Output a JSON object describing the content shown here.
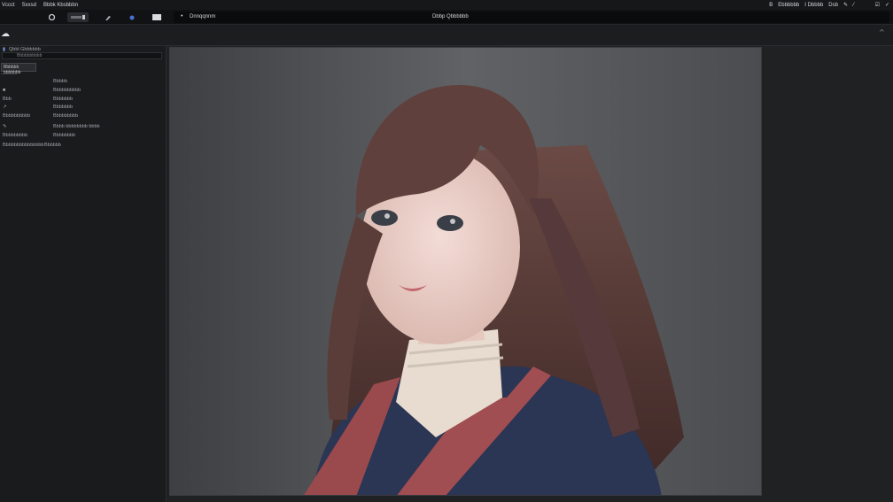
{
  "app": {
    "menu": [
      "Vccct",
      "Sxxsd",
      "Bbbk Kbsbbbn"
    ],
    "document_title": "Dbbp Qbbbbbb",
    "tab_label": "Dnnqqnnm",
    "status_right": [
      "B",
      "Ebbbbbb",
      "I Dbbbb",
      "Dsb"
    ]
  },
  "panel": {
    "header": "Qbbl Gbbbbbb",
    "search_value": "Bbbbbbbbbb",
    "section_label": "Bbbbbb bbbbbbb",
    "rows": [
      {
        "left": "",
        "mid": "Bbbbb",
        "right": ""
      },
      {
        "left": "",
        "mid": "",
        "right": "Bbbbbbbbbb"
      },
      {
        "left": "Bbb",
        "mid": "",
        "right": "Bbbbbbb"
      },
      {
        "left": "",
        "mid": "",
        "right": "Bbbbbbb"
      },
      {
        "left": "Bbbbbbbbbb",
        "mid": "",
        "right": "Bbbbbbbbb"
      },
      {
        "left": "",
        "mid": "",
        "right": "Bbbb bbbbbbbb bbbb"
      },
      {
        "left": "Bbbbbbbbb",
        "mid": "",
        "right": "Bbbbbbbb"
      },
      {
        "left": "Bbbbbbbbbbbbbbb",
        "mid": "Bbbbbb",
        "right": ""
      }
    ]
  },
  "colors": {
    "app_bg": "#1e1f21",
    "panel_bg": "#1a1b1d",
    "photo_bg": "#5a5b5e"
  },
  "icons": [
    "cloud-icon",
    "file-icon",
    "brush-icon",
    "layers-icon",
    "collapse-icon",
    "pen-icon",
    "checkbox-icon"
  ]
}
